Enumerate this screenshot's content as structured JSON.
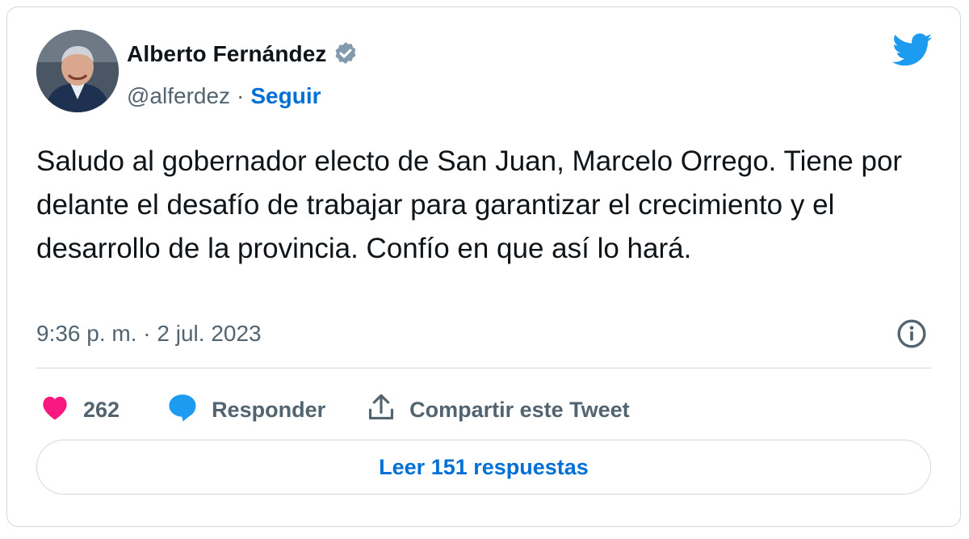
{
  "author": {
    "name": "Alberto Fernández",
    "handle": "@alferdez",
    "separator": "·",
    "follow_label": "Seguir",
    "verified": true
  },
  "tweet": {
    "text": "Saludo al gobernador electo de San Juan, Marcelo Orrego. Tiene por delante el desafío de trabajar para garantizar el crecimiento y el desarrollo de la provincia. Confío en que así lo hará.",
    "timestamp": "9:36 p. m. · 2 jul. 2023"
  },
  "actions": {
    "likes": "262",
    "reply_label": "Responder",
    "share_label": "Compartir este Tweet"
  },
  "read_replies_label": "Leer 151 respuestas",
  "icons": {
    "like": "heart-icon",
    "reply": "speech-bubble-icon",
    "share": "share-upload-icon",
    "info": "info-icon",
    "brand": "twitter-bird-icon",
    "verified": "verified-badge-icon"
  },
  "colors": {
    "link": "#006fd6",
    "twitter_blue": "#1d9bf0",
    "like_pink": "#f91880",
    "text": "#0f1419",
    "muted": "#536471",
    "border": "#cfd9de"
  }
}
